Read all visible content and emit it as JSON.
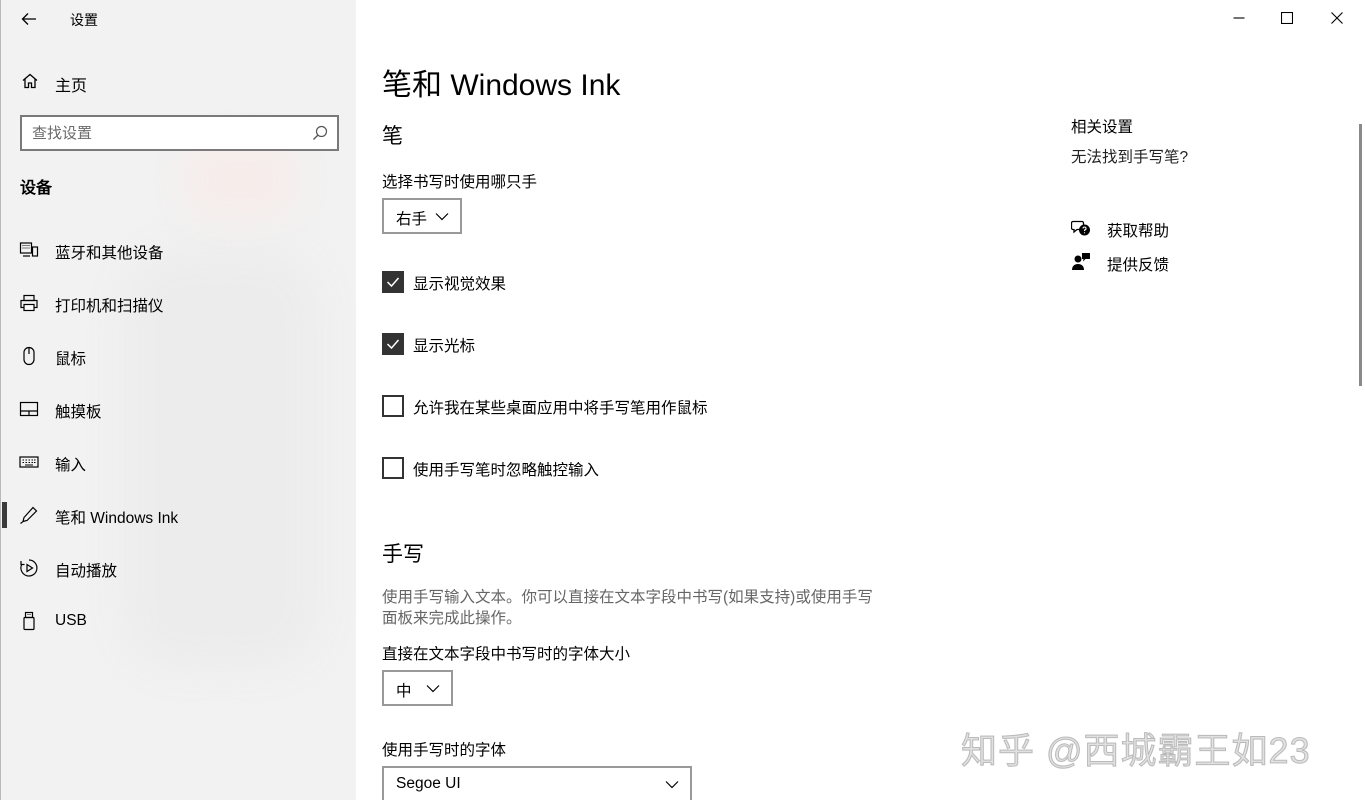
{
  "window": {
    "title": "设置",
    "back_icon": "back-arrow-icon",
    "controls": [
      "minimize",
      "maximize",
      "close"
    ]
  },
  "sidebar": {
    "home_label": "主页",
    "search_placeholder": "查找设置",
    "section": "设备",
    "items": [
      {
        "label": "蓝牙和其他设备",
        "icon": "bluetooth-devices-icon",
        "selected": false
      },
      {
        "label": "打印机和扫描仪",
        "icon": "printer-icon",
        "selected": false
      },
      {
        "label": "鼠标",
        "icon": "mouse-icon",
        "selected": false
      },
      {
        "label": "触摸板",
        "icon": "touchpad-icon",
        "selected": false
      },
      {
        "label": "输入",
        "icon": "keyboard-icon",
        "selected": false
      },
      {
        "label": "笔和 Windows Ink",
        "icon": "pen-icon",
        "selected": true
      },
      {
        "label": "自动播放",
        "icon": "autoplay-icon",
        "selected": false
      },
      {
        "label": "USB",
        "icon": "usb-icon",
        "selected": false
      }
    ]
  },
  "main": {
    "title": "笔和 Windows Ink",
    "pen": {
      "heading": "笔",
      "hand_label": "选择书写时使用哪只手",
      "hand_value": "右手",
      "checkboxes": [
        {
          "label": "显示视觉效果",
          "checked": true
        },
        {
          "label": "显示光标",
          "checked": true
        },
        {
          "label": "允许我在某些桌面应用中将手写笔用作鼠标",
          "checked": false
        },
        {
          "label": "使用手写笔时忽略触控输入",
          "checked": false
        }
      ]
    },
    "handwriting": {
      "heading": "手写",
      "description": "使用手写输入文本。你可以直接在文本字段中书写(如果支持)或使用手写面板来完成此操作。",
      "font_size_label": "直接在文本字段中书写时的字体大小",
      "font_size_value": "中",
      "font_label": "使用手写时的字体",
      "font_value": "Segoe UI"
    },
    "related": {
      "heading": "相关设置",
      "link": "无法找到手写笔?",
      "get_help": "获取帮助",
      "feedback": "提供反馈"
    }
  },
  "watermark": "知乎 @西城霸王如23"
}
